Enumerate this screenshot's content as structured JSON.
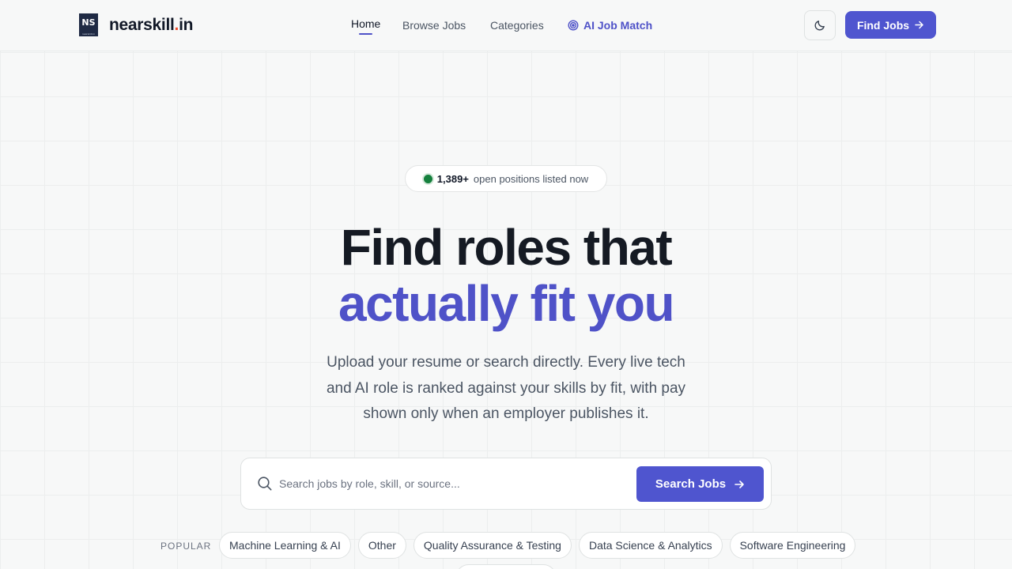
{
  "brand": {
    "logo_mark": "NS",
    "logo_mark_small": "nearskill.in",
    "name_main": "nearskill",
    "name_dot": ".",
    "name_tld": "in",
    "accent_color": "#4f55cf",
    "dot_color": "#ef4b2b"
  },
  "nav": {
    "home": "Home",
    "browse": "Browse Jobs",
    "categories": "Categories",
    "ai_match": "AI Job Match"
  },
  "header": {
    "theme_toggle_icon": "moon-icon",
    "find_jobs": "Find Jobs"
  },
  "badge": {
    "count": "1,389+",
    "text": "open positions listed now"
  },
  "hero": {
    "line1": "Find roles that",
    "line2": "actually fit you",
    "subtitle": "Upload your resume or search directly. Every live tech and AI role is ranked against your skills by fit, with pay shown only when an employer publishes it."
  },
  "search": {
    "placeholder": "Search jobs by role, skill, or source...",
    "value": "",
    "button": "Search Jobs"
  },
  "popular": {
    "label": "POPULAR",
    "chips": [
      "Machine Learning & AI",
      "Other",
      "Quality Assurance & Testing",
      "Data Science & Analytics",
      "Software Engineering"
    ]
  }
}
